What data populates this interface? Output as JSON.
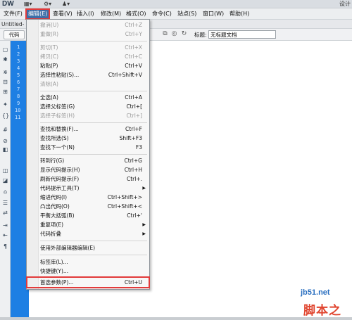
{
  "app": {
    "logo": "DW",
    "top_right": "设计"
  },
  "menubar": [
    {
      "label": "文件(F)",
      "active": false
    },
    {
      "label": "编辑(E)",
      "active": true
    },
    {
      "label": "查看(V)",
      "active": false
    },
    {
      "label": "插入(I)",
      "active": false
    },
    {
      "label": "修改(M)",
      "active": false
    },
    {
      "label": "格式(O)",
      "active": false
    },
    {
      "label": "命令(C)",
      "active": false
    },
    {
      "label": "站点(S)",
      "active": false
    },
    {
      "label": "窗口(W)",
      "active": false
    },
    {
      "label": "帮助(H)",
      "active": false
    }
  ],
  "document_tab": "Untitled-",
  "toolbar": {
    "code_label": "代码",
    "title_label": "标题:",
    "title_value": "无标题文档"
  },
  "line_numbers": [
    "1",
    "2",
    "3",
    "4",
    "5",
    "6",
    "7",
    "8",
    "9",
    "10",
    "11"
  ],
  "edit_menu": [
    {
      "label": "撤消(U)",
      "shortcut": "Ctrl+Z",
      "disabled": true
    },
    {
      "label": "重做(R)",
      "shortcut": "Ctrl+Y",
      "disabled": true
    },
    {
      "separator": true
    },
    {
      "label": "剪切(T)",
      "shortcut": "Ctrl+X",
      "disabled": true
    },
    {
      "label": "拷贝(C)",
      "shortcut": "Ctrl+C",
      "disabled": true
    },
    {
      "label": "粘贴(P)",
      "shortcut": "Ctrl+V",
      "disabled": false
    },
    {
      "label": "选择性粘贴(S)...",
      "shortcut": "Ctrl+Shift+V",
      "disabled": false
    },
    {
      "label": "清除(A)",
      "shortcut": "",
      "disabled": true
    },
    {
      "separator": true
    },
    {
      "label": "全选(A)",
      "shortcut": "Ctrl+A",
      "disabled": false
    },
    {
      "label": "选择父标签(G)",
      "shortcut": "Ctrl+[",
      "disabled": false
    },
    {
      "label": "选择子标签(H)",
      "shortcut": "Ctrl+]",
      "disabled": true
    },
    {
      "separator": true
    },
    {
      "label": "查找和替换(F)...",
      "shortcut": "Ctrl+F",
      "disabled": false
    },
    {
      "label": "查找所选(S)",
      "shortcut": "Shift+F3",
      "disabled": false
    },
    {
      "label": "查找下一个(N)",
      "shortcut": "F3",
      "disabled": false
    },
    {
      "separator": true
    },
    {
      "label": "转到行(G)",
      "shortcut": "Ctrl+G",
      "disabled": false
    },
    {
      "label": "显示代码提示(H)",
      "shortcut": "Ctrl+H",
      "disabled": false
    },
    {
      "label": "刷新代码提示(F)",
      "shortcut": "Ctrl+.",
      "disabled": false
    },
    {
      "label": "代码提示工具(T)",
      "shortcut": "",
      "submenu": true,
      "disabled": false
    },
    {
      "label": "缩进代码(I)",
      "shortcut": "Ctrl+Shift+>",
      "disabled": false
    },
    {
      "label": "凸出代码(O)",
      "shortcut": "Ctrl+Shift+<",
      "disabled": false
    },
    {
      "label": "平衡大括弧(B)",
      "shortcut": "Ctrl+'",
      "disabled": false
    },
    {
      "label": "重复项(E)",
      "shortcut": "",
      "submenu": true,
      "disabled": false
    },
    {
      "label": "代码折叠",
      "shortcut": "",
      "submenu": true,
      "disabled": false
    },
    {
      "separator": true
    },
    {
      "label": "使用外部编辑器编辑(E)",
      "shortcut": "",
      "disabled": false
    },
    {
      "separator": true
    },
    {
      "label": "标签库(L)...",
      "shortcut": "",
      "disabled": false
    },
    {
      "label": "快捷键(Y)...",
      "shortcut": "",
      "disabled": false
    },
    {
      "label": "首选参数(P)...",
      "shortcut": "Ctrl+U",
      "disabled": false,
      "highlight": true
    }
  ],
  "watermark": {
    "url": "jb51.net",
    "name": "脚本之家"
  },
  "colors": {
    "gutter": "#1e7fe3",
    "highlight_border": "#e23a3a",
    "menu_active": "#3b6ea8"
  }
}
